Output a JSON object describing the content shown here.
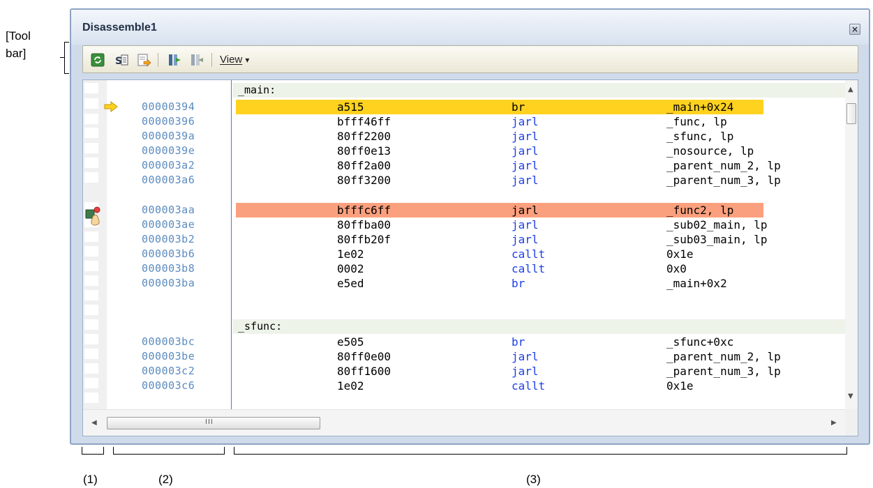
{
  "callouts": {
    "toolbar_line1": "[Tool",
    "toolbar_line2": "bar]",
    "mark1": "(1)",
    "mark2": "(2)",
    "mark3": "(3)"
  },
  "window": {
    "title": "Disassemble1",
    "close_glyph": "×"
  },
  "toolbar": {
    "buttons": [
      "refresh-icon",
      "source-view-icon",
      "go-to-address-icon",
      "step-forward-icon",
      "step-back-icon"
    ],
    "view_label": "View",
    "view_arrow": "▾"
  },
  "listing": {
    "label_main": "_main:",
    "label_sfunc": "_sfunc:",
    "rows": [
      {
        "addr": "00000394",
        "code": "a515",
        "mnem": "br",
        "oper": "_main+0x24"
      },
      {
        "addr": "00000396",
        "code": "bfff46ff",
        "mnem": "jarl",
        "oper": "_func, lp"
      },
      {
        "addr": "0000039a",
        "code": "80ff2200",
        "mnem": "jarl",
        "oper": "_sfunc, lp"
      },
      {
        "addr": "0000039e",
        "code": "80ff0e13",
        "mnem": "jarl",
        "oper": "_nosource, lp"
      },
      {
        "addr": "000003a2",
        "code": "80ff2a00",
        "mnem": "jarl",
        "oper": "_parent_num_2, lp"
      },
      {
        "addr": "000003a6",
        "code": "80ff3200",
        "mnem": "jarl",
        "oper": "_parent_num_3, lp"
      },
      {
        "addr": "000003aa",
        "code": "bfffc6ff",
        "mnem": "jarl",
        "oper": "_func2, lp"
      },
      {
        "addr": "000003ae",
        "code": "80ffba00",
        "mnem": "jarl",
        "oper": "_sub02_main, lp"
      },
      {
        "addr": "000003b2",
        "code": "80ffb20f",
        "mnem": "jarl",
        "oper": "_sub03_main, lp"
      },
      {
        "addr": "000003b6",
        "code": "1e02",
        "mnem": "callt",
        "oper": "0x1e"
      },
      {
        "addr": "000003b8",
        "code": "0002",
        "mnem": "callt",
        "oper": "0x0"
      },
      {
        "addr": "000003ba",
        "code": "e5ed",
        "mnem": "br",
        "oper": "_main+0x2"
      },
      {
        "addr": "000003bc",
        "code": "e505",
        "mnem": "br",
        "oper": "_sfunc+0xc"
      },
      {
        "addr": "000003be",
        "code": "80ff0e00",
        "mnem": "jarl",
        "oper": "_parent_num_2, lp"
      },
      {
        "addr": "000003c2",
        "code": "80ff1600",
        "mnem": "jarl",
        "oper": "_parent_num_3, lp"
      },
      {
        "addr": "000003c6",
        "code": "1e02",
        "mnem": "callt",
        "oper": "0x1e"
      }
    ]
  },
  "colors": {
    "current_pc": "#ffd21f",
    "breakpoint": "#fba07e",
    "mnemonic": "#1c3ee6",
    "address": "#5a8bc0"
  },
  "scrollbar": {
    "grip": "III"
  }
}
